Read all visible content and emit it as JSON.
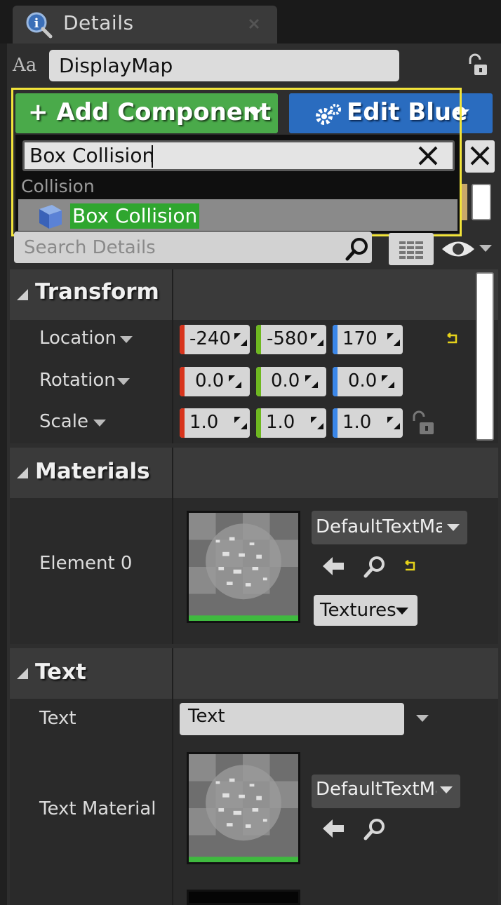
{
  "tab": {
    "title": "Details",
    "icon": "details-icon"
  },
  "actor_name": "DisplayMap",
  "toolbar": {
    "add_component_label": "Add Component",
    "edit_blueprint_label": "Edit Blue",
    "add_color": "#4aaa4a",
    "edit_color": "#2a6cbf"
  },
  "component_popup": {
    "search_value": "Box Collision",
    "category": "Collision",
    "item_label": "Box Collision",
    "highlight_color": "#f2e43a"
  },
  "details_search": {
    "placeholder": "Search Details"
  },
  "transform": {
    "title": "Transform",
    "location": {
      "label": "Location",
      "x": "-240",
      "y": "-580",
      "z": "170.0"
    },
    "rotation": {
      "label": "Rotation",
      "x": "0.0",
      "y": "0.0",
      "z": "0.0"
    },
    "scale": {
      "label": "Scale",
      "x": "1.0",
      "y": "1.0",
      "z": "1.0"
    }
  },
  "materials": {
    "title": "Materials",
    "element_label": "Element 0",
    "material_name": "DefaultTextMat",
    "textures_label": "Textures"
  },
  "text_section": {
    "title": "Text",
    "text_label": "Text",
    "text_value": "Text",
    "text_material_label": "Text Material",
    "text_material_name": "DefaultTextMa"
  },
  "axis_colors": {
    "x": "#d8341c",
    "y": "#6eb820",
    "z": "#3a86e8"
  }
}
